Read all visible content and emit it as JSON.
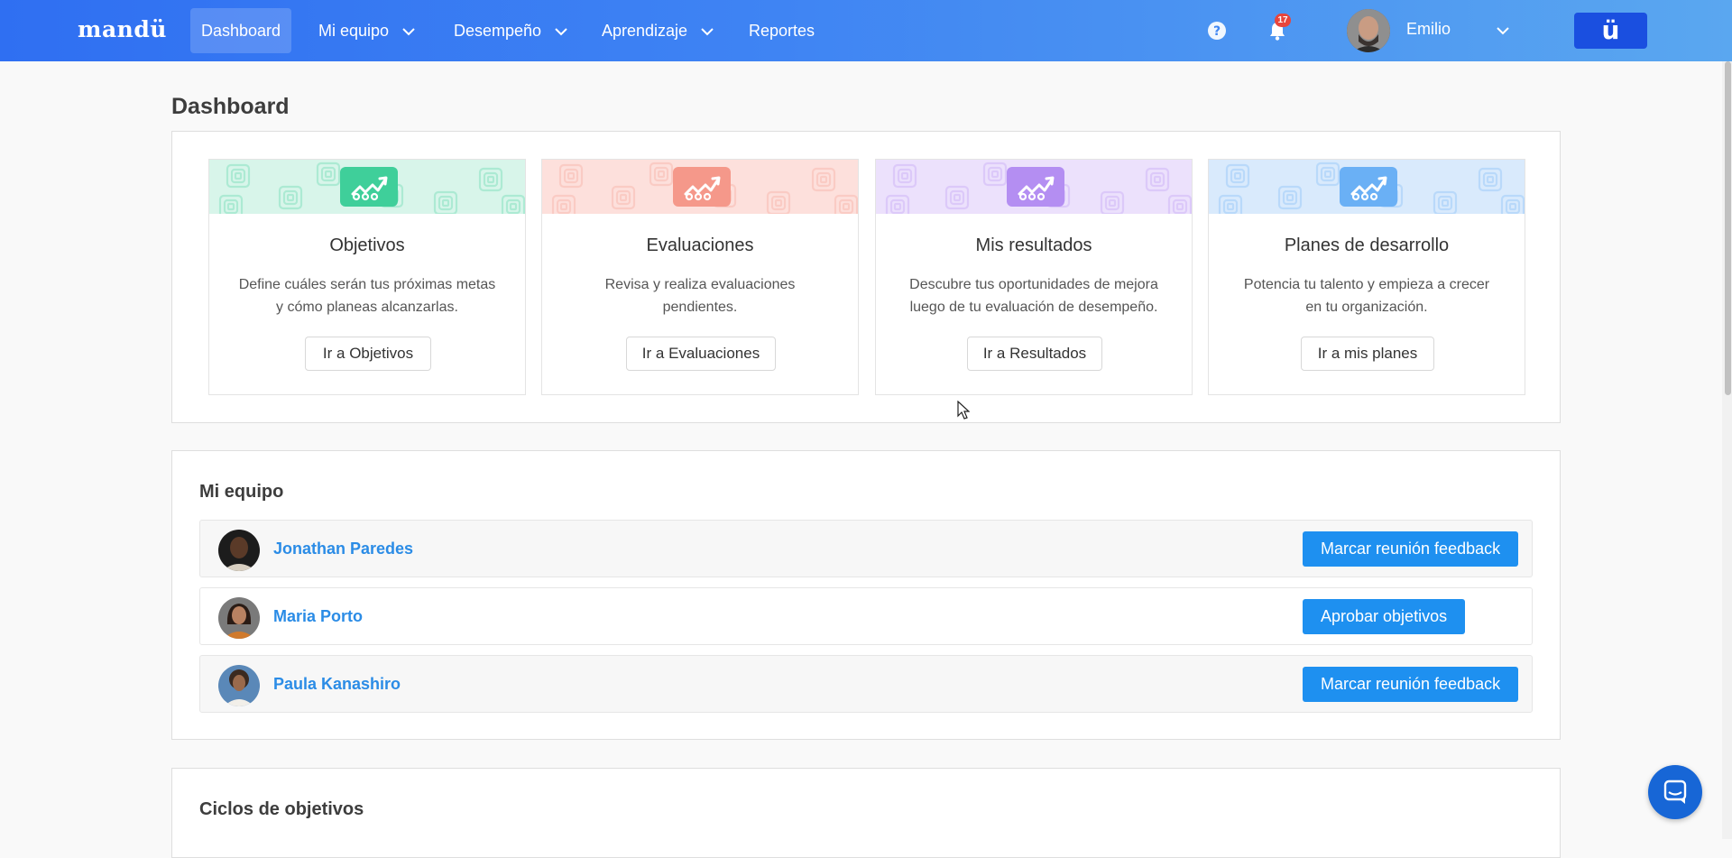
{
  "app": {
    "logo": "mandü",
    "brand_button_label": "ü"
  },
  "nav": {
    "items": [
      {
        "label": "Dashboard",
        "active": true
      },
      {
        "label": "Mi equipo",
        "has_dropdown": true
      },
      {
        "label": "Desempeño",
        "has_dropdown": true
      },
      {
        "label": "Aprendizaje",
        "has_dropdown": true
      },
      {
        "label": "Reportes"
      }
    ],
    "notification_count": "17",
    "user_name": "Emilio",
    "icons": [
      "help-icon",
      "bell-icon",
      "chevron-down-icon"
    ]
  },
  "page": {
    "title": "Dashboard"
  },
  "shortcuts": [
    {
      "title": "Objetivos",
      "desc_line1": "Define cuáles serán tus próximas metas",
      "desc_line2": "y cómo planeas alcanzarlas.",
      "button": "Ir a Objetivos",
      "color": "#3fcf9a",
      "banner_color": "#d8f5ea"
    },
    {
      "title": "Evaluaciones",
      "desc_line1": "Revisa y realiza evaluaciones",
      "desc_line2": "pendientes.",
      "button": "Ir a Evaluaciones",
      "color": "#f5988a",
      "banner_color": "#fde0dc"
    },
    {
      "title": "Mis resultados",
      "desc_line1": "Descubre tus oportunidades de mejora",
      "desc_line2": "luego de tu evaluación de desempeño.",
      "button": "Ir a Resultados",
      "color": "#b48ef2",
      "banner_color": "#ece1fc"
    },
    {
      "title": "Planes de desarrollo",
      "desc_line1": "Potencia tu talento y empieza a crecer",
      "desc_line2": "en tu organización.",
      "button": "Ir a mis planes",
      "color": "#6ab0f5",
      "banner_color": "#d9eafc"
    }
  ],
  "team": {
    "title": "Mi equipo",
    "members": [
      {
        "name": "Jonathan Paredes",
        "action": "Marcar reunión feedback"
      },
      {
        "name": "Maria Porto",
        "action": "Aprobar objetivos"
      },
      {
        "name": "Paula Kanashiro",
        "action": "Marcar reunión feedback"
      }
    ]
  },
  "cycles": {
    "title": "Ciclos de objetivos"
  }
}
